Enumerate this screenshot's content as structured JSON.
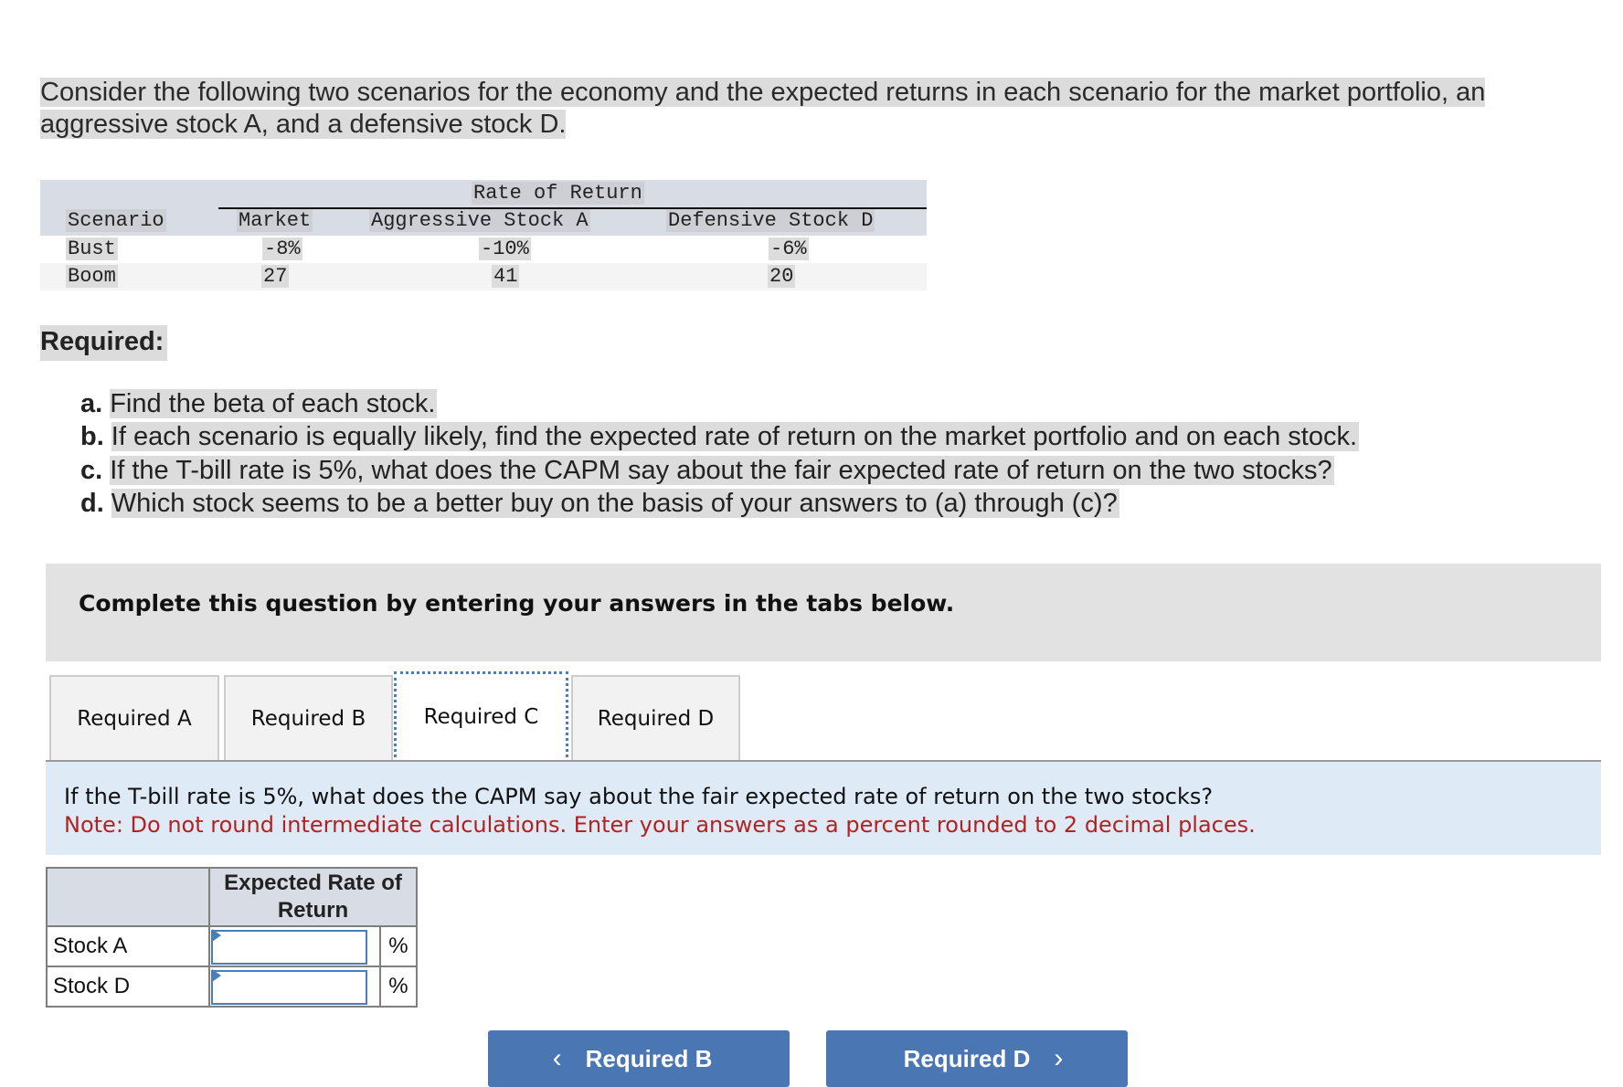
{
  "intro": {
    "line1": "Consider the following two scenarios for the economy and the expected returns in each scenario for the market portfolio, an",
    "line2": "aggressive stock A, and a defensive stock D."
  },
  "data_table": {
    "group_header": "Rate of Return",
    "columns": [
      "Scenario",
      "Market",
      "Aggressive Stock A",
      "Defensive Stock D"
    ],
    "rows": [
      {
        "scenario": "Bust",
        "market": "-8%",
        "stock_a": "-10%",
        "stock_d": "-6%"
      },
      {
        "scenario": "Boom",
        "market": "27",
        "stock_a": "41",
        "stock_d": "20"
      }
    ]
  },
  "required": {
    "heading": "Required:",
    "items": [
      {
        "label": "a.",
        "text": "Find the beta of each stock."
      },
      {
        "label": "b.",
        "text": "If each scenario is equally likely, find the expected rate of return on the market portfolio and on each stock."
      },
      {
        "label": "c.",
        "text": "If the T-bill rate is 5%, what does the CAPM say about the fair expected rate of return on the two stocks?"
      },
      {
        "label": "d.",
        "text": "Which stock seems to be a better buy on the basis of your answers to (a) through (c)?"
      }
    ]
  },
  "instruction": "Complete this question by entering your answers in the tabs below.",
  "tabs": [
    {
      "label": "Required A",
      "active": false
    },
    {
      "label": "Required B",
      "active": false
    },
    {
      "label": "Required C",
      "active": true
    },
    {
      "label": "Required D",
      "active": false
    }
  ],
  "question": {
    "text": "If the T-bill rate is 5%, what does the CAPM say about the fair expected rate of return on the two stocks?",
    "note": "Note: Do not round intermediate calculations. Enter your answers as a percent rounded to 2 decimal places."
  },
  "answer_table": {
    "header": "Expected Rate of Return",
    "rows": [
      {
        "label": "Stock A",
        "value": "",
        "unit": "%"
      },
      {
        "label": "Stock D",
        "value": "",
        "unit": "%"
      }
    ]
  },
  "nav": {
    "prev_label": "Required B",
    "next_label": "Required D",
    "prev_icon": "‹",
    "next_icon": "›"
  },
  "colors": {
    "button_blue": "#4a76b4",
    "note_red": "#b22222",
    "question_bg": "#deeaf6",
    "focus_blue": "#4a7ebb"
  }
}
